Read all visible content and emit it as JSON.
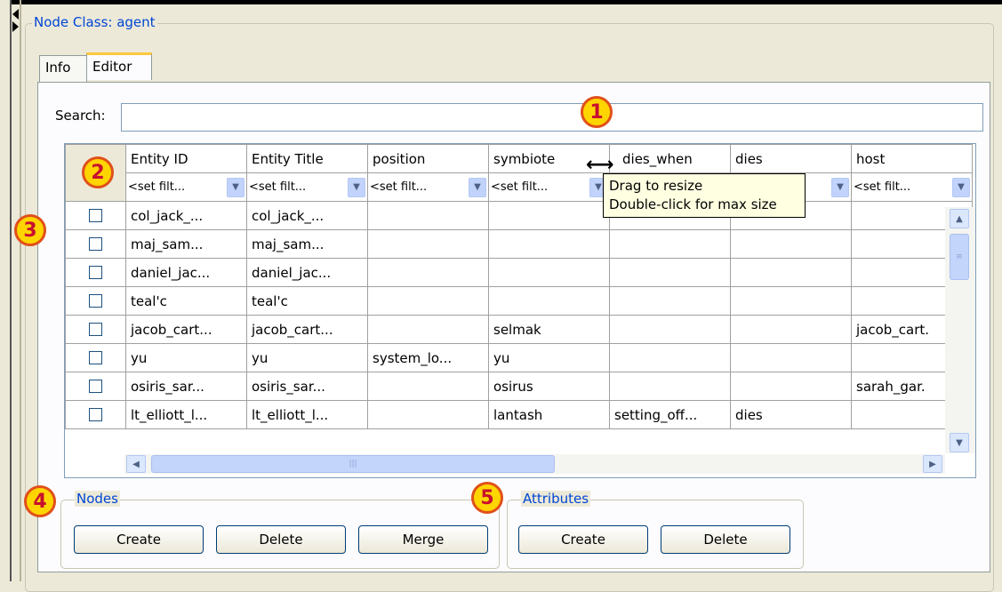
{
  "node_class_label": "Node Class: agent",
  "tabs": [
    {
      "label": "Info",
      "active": false
    },
    {
      "label": "Editor",
      "active": true
    }
  ],
  "search": {
    "label": "Search:",
    "value": ""
  },
  "grid": {
    "columns": [
      "Entity ID",
      "Entity Title",
      "position",
      "symbiote",
      "dies_when",
      "dies",
      "host"
    ],
    "filter_placeholder": "<set filt...",
    "rows": [
      [
        "col_jack_...",
        "col_jack_...",
        "",
        "",
        "",
        "",
        ""
      ],
      [
        "maj_sam...",
        "maj_sam...",
        "",
        "",
        "",
        "",
        ""
      ],
      [
        "daniel_jac...",
        "daniel_jac...",
        "",
        "",
        "",
        "",
        ""
      ],
      [
        "teal'c",
        "teal'c",
        "",
        "",
        "",
        "",
        ""
      ],
      [
        "jacob_cart...",
        "jacob_cart...",
        "",
        "selmak",
        "",
        "",
        "jacob_cart."
      ],
      [
        "yu",
        "yu",
        "system_lo...",
        "yu",
        "",
        "",
        ""
      ],
      [
        "osiris_sar...",
        "osiris_sar...",
        "",
        "osirus",
        "",
        "",
        "sarah_gar."
      ],
      [
        "lt_elliott_l...",
        "lt_elliott_l...",
        "",
        "lantash",
        "setting_off...",
        "dies",
        ""
      ]
    ]
  },
  "tooltip": {
    "line1": "Drag to resize",
    "line2": "Double-click for max size"
  },
  "nodes_group": {
    "label": "Nodes",
    "create": "Create",
    "delete": "Delete",
    "merge": "Merge"
  },
  "attributes_group": {
    "label": "Attributes",
    "create": "Create",
    "delete": "Delete"
  },
  "callouts": [
    "1",
    "2",
    "3",
    "4",
    "5"
  ],
  "icons": {
    "resize": "resize-horizontal-icon",
    "scroll_up": "arrow-up-icon",
    "scroll_down": "arrow-down-icon",
    "scroll_left": "arrow-left-icon",
    "scroll_right": "arrow-right-icon",
    "dropdown": "chevron-down-icon"
  },
  "colors": {
    "accent_blue": "#0046d5",
    "callout_fill": "#ffd500",
    "callout_border": "#e0501a",
    "tooltip_bg": "#ffffe1"
  }
}
